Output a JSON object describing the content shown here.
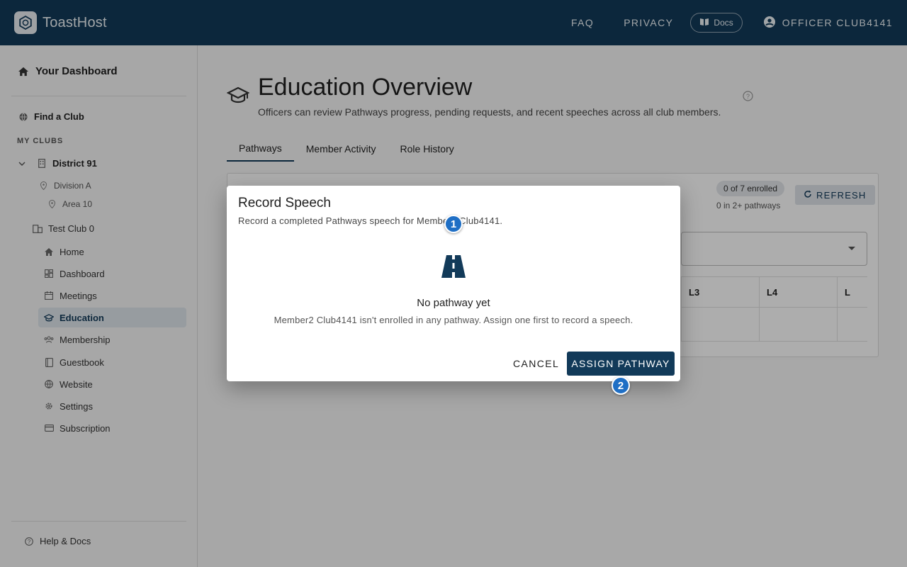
{
  "app": {
    "title": "ToastHost"
  },
  "topnav": {
    "faq": "FAQ",
    "privacy": "PRIVACY",
    "docs": "Docs",
    "user": "OFFICER CLUB4141"
  },
  "sidebar": {
    "dashboard": "Your Dashboard",
    "find_club": "Find a Club",
    "my_clubs_label": "MY CLUBS",
    "district": "District 91",
    "division": "Division A",
    "area": "Area 10",
    "club": "Test Club 0",
    "items": [
      {
        "label": "Home"
      },
      {
        "label": "Dashboard"
      },
      {
        "label": "Meetings"
      },
      {
        "label": "Education"
      },
      {
        "label": "Membership"
      },
      {
        "label": "Guestbook"
      },
      {
        "label": "Website"
      },
      {
        "label": "Settings"
      },
      {
        "label": "Subscription"
      }
    ],
    "help": "Help & Docs"
  },
  "main": {
    "title": "Education Overview",
    "subtitle": "Officers can review Pathways progress, pending requests, and recent speeches across all club members.",
    "tabs": [
      "Pathways",
      "Member Activity",
      "Role History"
    ],
    "card": {
      "chip": "0 of 7 enrolled",
      "chip_sub": "0 in 2+ pathways",
      "refresh": "REFRESH",
      "columns": [
        "L3",
        "L4",
        "L"
      ]
    }
  },
  "dialog": {
    "title": "Record Speech",
    "subtitle": "Record a completed Pathways speech for Member2 Club4141.",
    "empty_title": "No pathway yet",
    "empty_sub": "Member2 Club4141 isn't enrolled in any pathway. Assign one first to record a speech.",
    "cancel": "CANCEL",
    "assign": "ASSIGN PATHWAY"
  },
  "markers": [
    "1",
    "2"
  ],
  "colors": {
    "primary": "#123a59",
    "marker": "#1f6fc5"
  }
}
